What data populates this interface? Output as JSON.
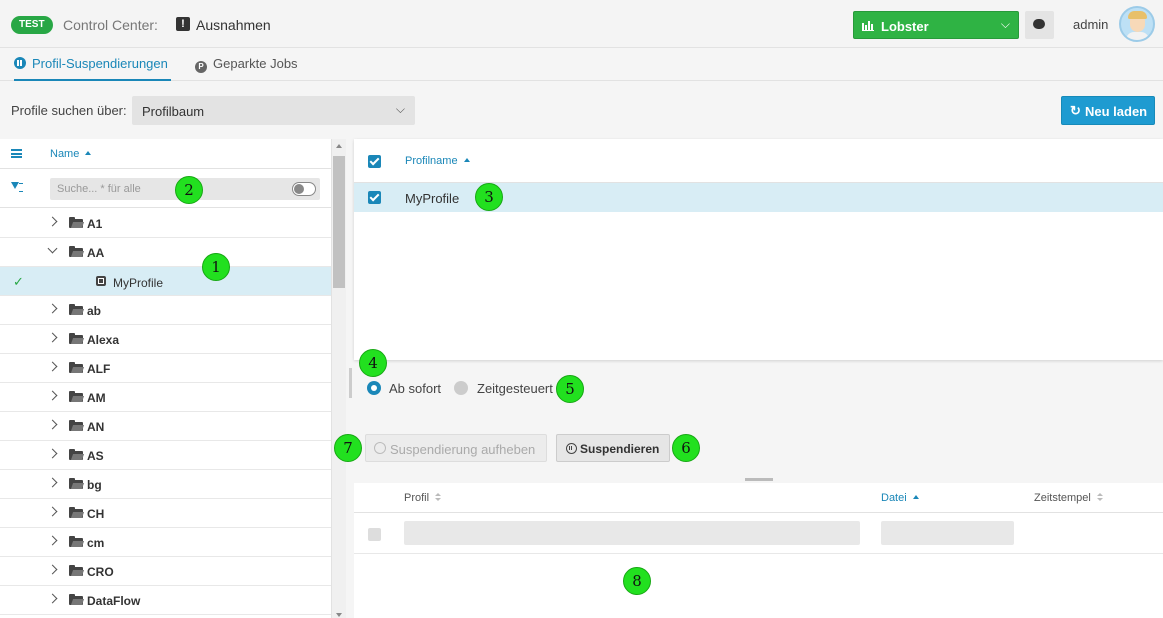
{
  "header": {
    "env_badge": "TEST",
    "app_title": "Control Center:",
    "page_title": "Ausnahmen",
    "instance_select": "Lobster",
    "user": "admin"
  },
  "tabs": [
    {
      "label": "Profil-Suspendierungen",
      "active": true
    },
    {
      "label": "Geparkte Jobs",
      "active": false
    }
  ],
  "search": {
    "label": "Profile suchen über:",
    "mode": "Profilbaum",
    "reload_label": "Neu laden"
  },
  "tree": {
    "column_name": "Name",
    "search_placeholder": "Suche... * für alle",
    "items": [
      {
        "label": "A1",
        "expanded": false
      },
      {
        "label": "AA",
        "expanded": true
      },
      {
        "label": "MyProfile",
        "leaf": true,
        "selected": true
      },
      {
        "label": "ab",
        "expanded": false
      },
      {
        "label": "Alexa",
        "expanded": false
      },
      {
        "label": "ALF",
        "expanded": false
      },
      {
        "label": "AM",
        "expanded": false
      },
      {
        "label": "AN",
        "expanded": false
      },
      {
        "label": "AS",
        "expanded": false
      },
      {
        "label": "bg",
        "expanded": false
      },
      {
        "label": "CH",
        "expanded": false
      },
      {
        "label": "cm",
        "expanded": false
      },
      {
        "label": "CRO",
        "expanded": false
      },
      {
        "label": "DataFlow",
        "expanded": false
      }
    ]
  },
  "selected_grid": {
    "column": "Profilname",
    "rows": [
      {
        "label": "MyProfile",
        "checked": true
      }
    ]
  },
  "timing": {
    "option_now": "Ab sofort",
    "option_scheduled": "Zeitgesteuert",
    "selected": "Ab sofort"
  },
  "actions": {
    "unsuspend_label": "Suspendierung aufheben",
    "suspend_label": "Suspendieren"
  },
  "bottom_grid": {
    "columns": [
      "Profil",
      "Datei",
      "Zeitstempel"
    ],
    "sorted_column": "Datei"
  },
  "markers": [
    "1",
    "2",
    "3",
    "4",
    "5",
    "6",
    "7",
    "8"
  ],
  "colors": {
    "accent": "#1a87b8",
    "env_badge": "#28a745",
    "instance_select": "#2fb344",
    "marker": "#22e01f"
  }
}
